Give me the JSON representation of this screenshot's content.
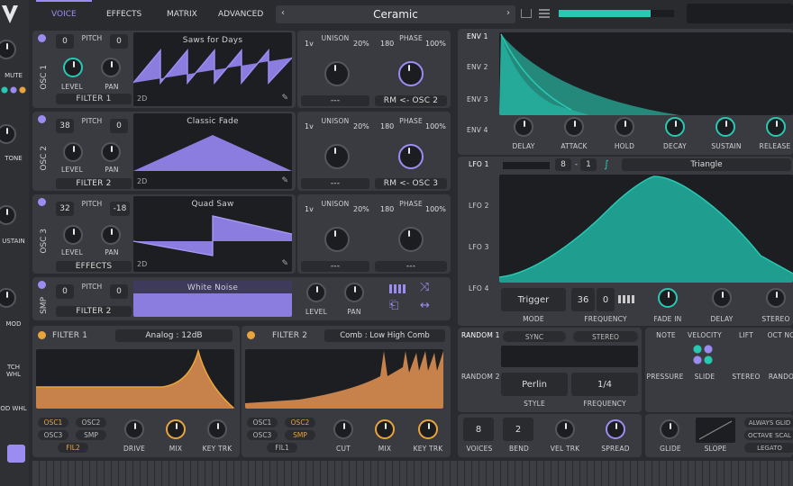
{
  "header": {
    "tabs": [
      "VOICE",
      "EFFECTS",
      "MATRIX",
      "ADVANCED"
    ],
    "preset_name": "Ceramic"
  },
  "sidebar": {
    "items": [
      "MUTE",
      "TONE",
      "USTAIN",
      "MOD",
      "TCH WHL",
      "OD WHL"
    ]
  },
  "osc": [
    {
      "id": "OSC 1",
      "pitch_label": "PITCH",
      "coarse": "0",
      "fine": "0",
      "level": "LEVEL",
      "pan": "PAN",
      "route": "FILTER 1",
      "wave": "Saws for Days",
      "dim": "2D",
      "unison": "UNISON",
      "voices": "1v",
      "uni_pct": "20%",
      "phase": "PHASE",
      "phase_val": "180",
      "phase_pct": "100%",
      "dash": "---",
      "rm": "RM <- OSC 2"
    },
    {
      "id": "OSC 2",
      "pitch_label": "PITCH",
      "coarse": "38",
      "fine": "0",
      "level": "LEVEL",
      "pan": "PAN",
      "route": "FILTER 2",
      "wave": "Classic Fade",
      "dim": "2D",
      "unison": "UNISON",
      "voices": "1v",
      "uni_pct": "20%",
      "phase": "PHASE",
      "phase_val": "180",
      "phase_pct": "100%",
      "dash": "---",
      "rm": "RM <- OSC 3"
    },
    {
      "id": "OSC 3",
      "pitch_label": "PITCH",
      "coarse": "32",
      "fine": "-18",
      "level": "LEVEL",
      "pan": "PAN",
      "route": "EFFECTS",
      "wave": "Quad Saw",
      "dim": "2D",
      "unison": "UNISON",
      "voices": "1v",
      "uni_pct": "20%",
      "phase": "PHASE",
      "phase_val": "180",
      "phase_pct": "100%",
      "dash": "---",
      "rm": "---"
    }
  ],
  "smp": {
    "id": "SMP",
    "pitch_label": "PITCH",
    "coarse": "0",
    "fine": "0",
    "route": "FILTER 2",
    "sample": "White Noise",
    "level": "LEVEL",
    "pan": "PAN"
  },
  "filter1": {
    "title": "FILTER 1",
    "model": "Analog : 12dB",
    "src": [
      "OSC1",
      "OSC2",
      "OSC3",
      "SMP"
    ],
    "fil": "FIL2",
    "knobs": [
      "DRIVE",
      "MIX",
      "KEY TRK"
    ]
  },
  "filter2": {
    "title": "FILTER 2",
    "model": "Comb : Low High Comb",
    "src": [
      "OSC1",
      "OSC2",
      "OSC3",
      "SMP"
    ],
    "fil": "FIL1",
    "knobs": [
      "CUT",
      "MIX",
      "KEY TRK"
    ]
  },
  "env": {
    "tabs": [
      "ENV 1",
      "ENV 2",
      "ENV 3",
      "ENV 4"
    ],
    "knobs": [
      "DELAY",
      "ATTACK",
      "HOLD",
      "DECAY",
      "SUSTAIN",
      "RELEASE"
    ]
  },
  "lfo": {
    "tabs": [
      "LFO 1",
      "LFO 2",
      "LFO 3",
      "LFO 4"
    ],
    "sync_a": "8",
    "sync_b": "1",
    "shape": "Triangle",
    "mode_val": "Trigger",
    "mode": "MODE",
    "freq_a": "36",
    "freq_b": "0",
    "freq": "FREQUENCY",
    "fadein": "FADE IN",
    "delay": "DELAY",
    "stereo": "STEREO"
  },
  "random": {
    "tabs": [
      "RANDOM 1",
      "RANDOM 2"
    ],
    "sync": "SYNC",
    "stereo": "STEREO",
    "style_val": "Perlin",
    "style": "STYLE",
    "freq_val": "1/4",
    "freq": "FREQUENCY"
  },
  "mods": {
    "note": "NOTE",
    "velocity": "VELOCITY",
    "lift": "LIFT",
    "oct": "OCT NO",
    "pressure": "PRESSURE",
    "slide": "SLIDE",
    "stereo": "STEREO",
    "rand": "RANDO"
  },
  "voice": {
    "voices_val": "8",
    "voices": "VOICES",
    "bend_val": "2",
    "bend": "BEND",
    "veltrk": "VEL TRK",
    "spread": "SPREAD",
    "glide": "GLIDE",
    "slope": "SLOPE",
    "always": "ALWAYS GLID",
    "octave": "OCTAVE SCAL",
    "legato": "LEGATO"
  },
  "colors": {
    "accent": "#28c8b2",
    "osc": "#9b8cf2",
    "filter": "#e9a43c"
  }
}
